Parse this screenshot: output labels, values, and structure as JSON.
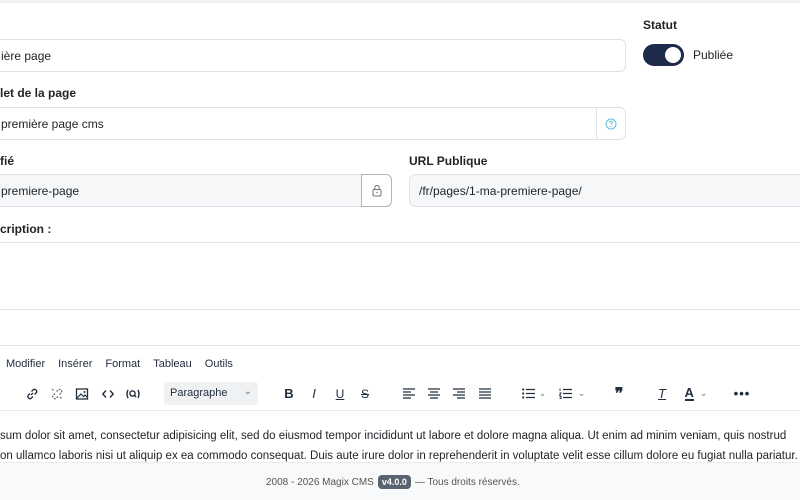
{
  "form": {
    "title": {
      "value": "ière page"
    },
    "meta_title": {
      "label": "let de la page",
      "value": "première page cms"
    },
    "slug": {
      "label": "fié",
      "value": "premiere-page"
    },
    "public_url": {
      "label": "URL Publique",
      "value": "/fr/pages/1-ma-premiere-page/"
    },
    "description": {
      "label": "cription :"
    }
  },
  "status": {
    "label": "Statut",
    "toggle_label": "Publiée",
    "published": true
  },
  "editor": {
    "menu": [
      "Modifier",
      "Insérer",
      "Format",
      "Tableau",
      "Outils"
    ],
    "block_format": "Paragraphe",
    "content_lines": [
      "sum dolor sit amet, consectetur adipisicing elit, sed do eiusmod tempor incididunt ut labore et dolore magna aliqua. Ut enim ad minim veniam, quis nostrud",
      "on ullamco laboris nisi ut aliquip ex ea commodo consequat. Duis aute irure dolor in reprehenderit in voluptate velit esse cillum dolore eu fugiat nulla pariatur."
    ]
  },
  "footer": {
    "years": "2008 - 2026 Magix CMS",
    "version": "v4.0.0",
    "rights": "— Tous droits réservés."
  },
  "colors": {
    "toggle_on": "#1e2a4a",
    "help_icon": "#5bc0de"
  }
}
